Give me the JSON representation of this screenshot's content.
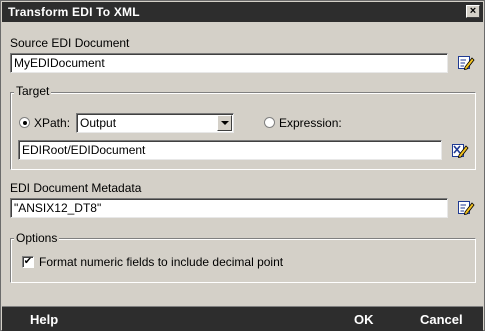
{
  "window": {
    "title": "Transform EDI To XML",
    "close_glyph": "×"
  },
  "source": {
    "label": "Source EDI Document",
    "value": "MyEDIDocument",
    "edit_icon": "edit-pencil-icon"
  },
  "target": {
    "legend": "Target",
    "xpath_label": "XPath:",
    "xpath_selected": true,
    "xpath_value": "Output",
    "expression_label": "Expression:",
    "expression_selected": false,
    "path_value": "EDIRoot/EDIDocument",
    "path_icon": "xpath-builder-icon"
  },
  "metadata": {
    "label": "EDI Document Metadata",
    "value": "\"ANSIX12_DT8\"",
    "edit_icon": "edit-pencil-icon"
  },
  "options": {
    "legend": "Options",
    "format_numeric": {
      "label": "Format numeric fields to include decimal point",
      "checked": true,
      "check_glyph": "✔"
    }
  },
  "footer": {
    "help": "Help",
    "ok": "OK",
    "cancel": "Cancel"
  },
  "colors": {
    "titlebar": "#2d2d2d",
    "dialog_bg": "#d4d0c8",
    "footer": "#2d2d2d"
  }
}
